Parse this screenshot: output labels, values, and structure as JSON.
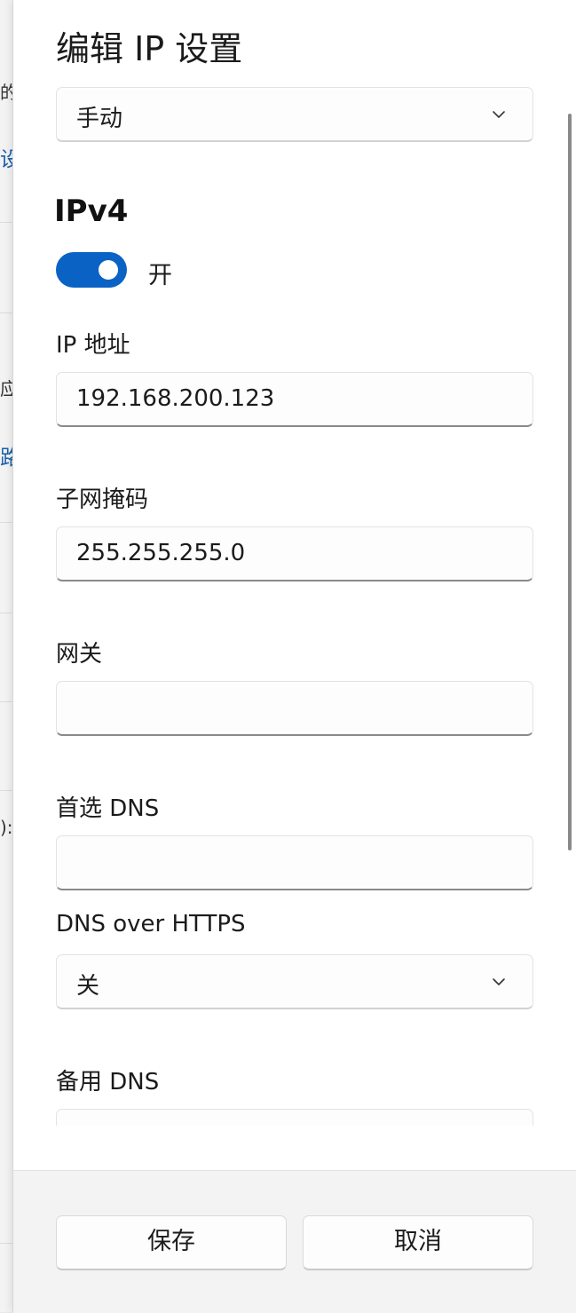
{
  "background": {
    "fragments": [
      "的",
      "设置",
      "应",
      "路由",
      "):"
    ]
  },
  "dialog": {
    "title": "编辑 IP 设置",
    "mode_dropdown": {
      "value": "手动",
      "icon": "chevron-down-icon"
    },
    "ipv4": {
      "section_title": "IPv4",
      "toggle": {
        "state": "on",
        "label": "开",
        "accent": "#0a63c4"
      },
      "ip_address": {
        "label": "IP 地址",
        "value": "192.168.200.123"
      },
      "subnet_mask": {
        "label": "子网掩码",
        "value": "255.255.255.0"
      },
      "gateway": {
        "label": "网关",
        "value": ""
      },
      "preferred_dns": {
        "label": "首选 DNS",
        "value": ""
      },
      "dns_over_https": {
        "label": "DNS over HTTPS",
        "value": "关",
        "icon": "chevron-down-icon"
      },
      "alternate_dns": {
        "label": "备用 DNS",
        "value": ""
      }
    },
    "footer": {
      "save_label": "保存",
      "cancel_label": "取消"
    }
  }
}
